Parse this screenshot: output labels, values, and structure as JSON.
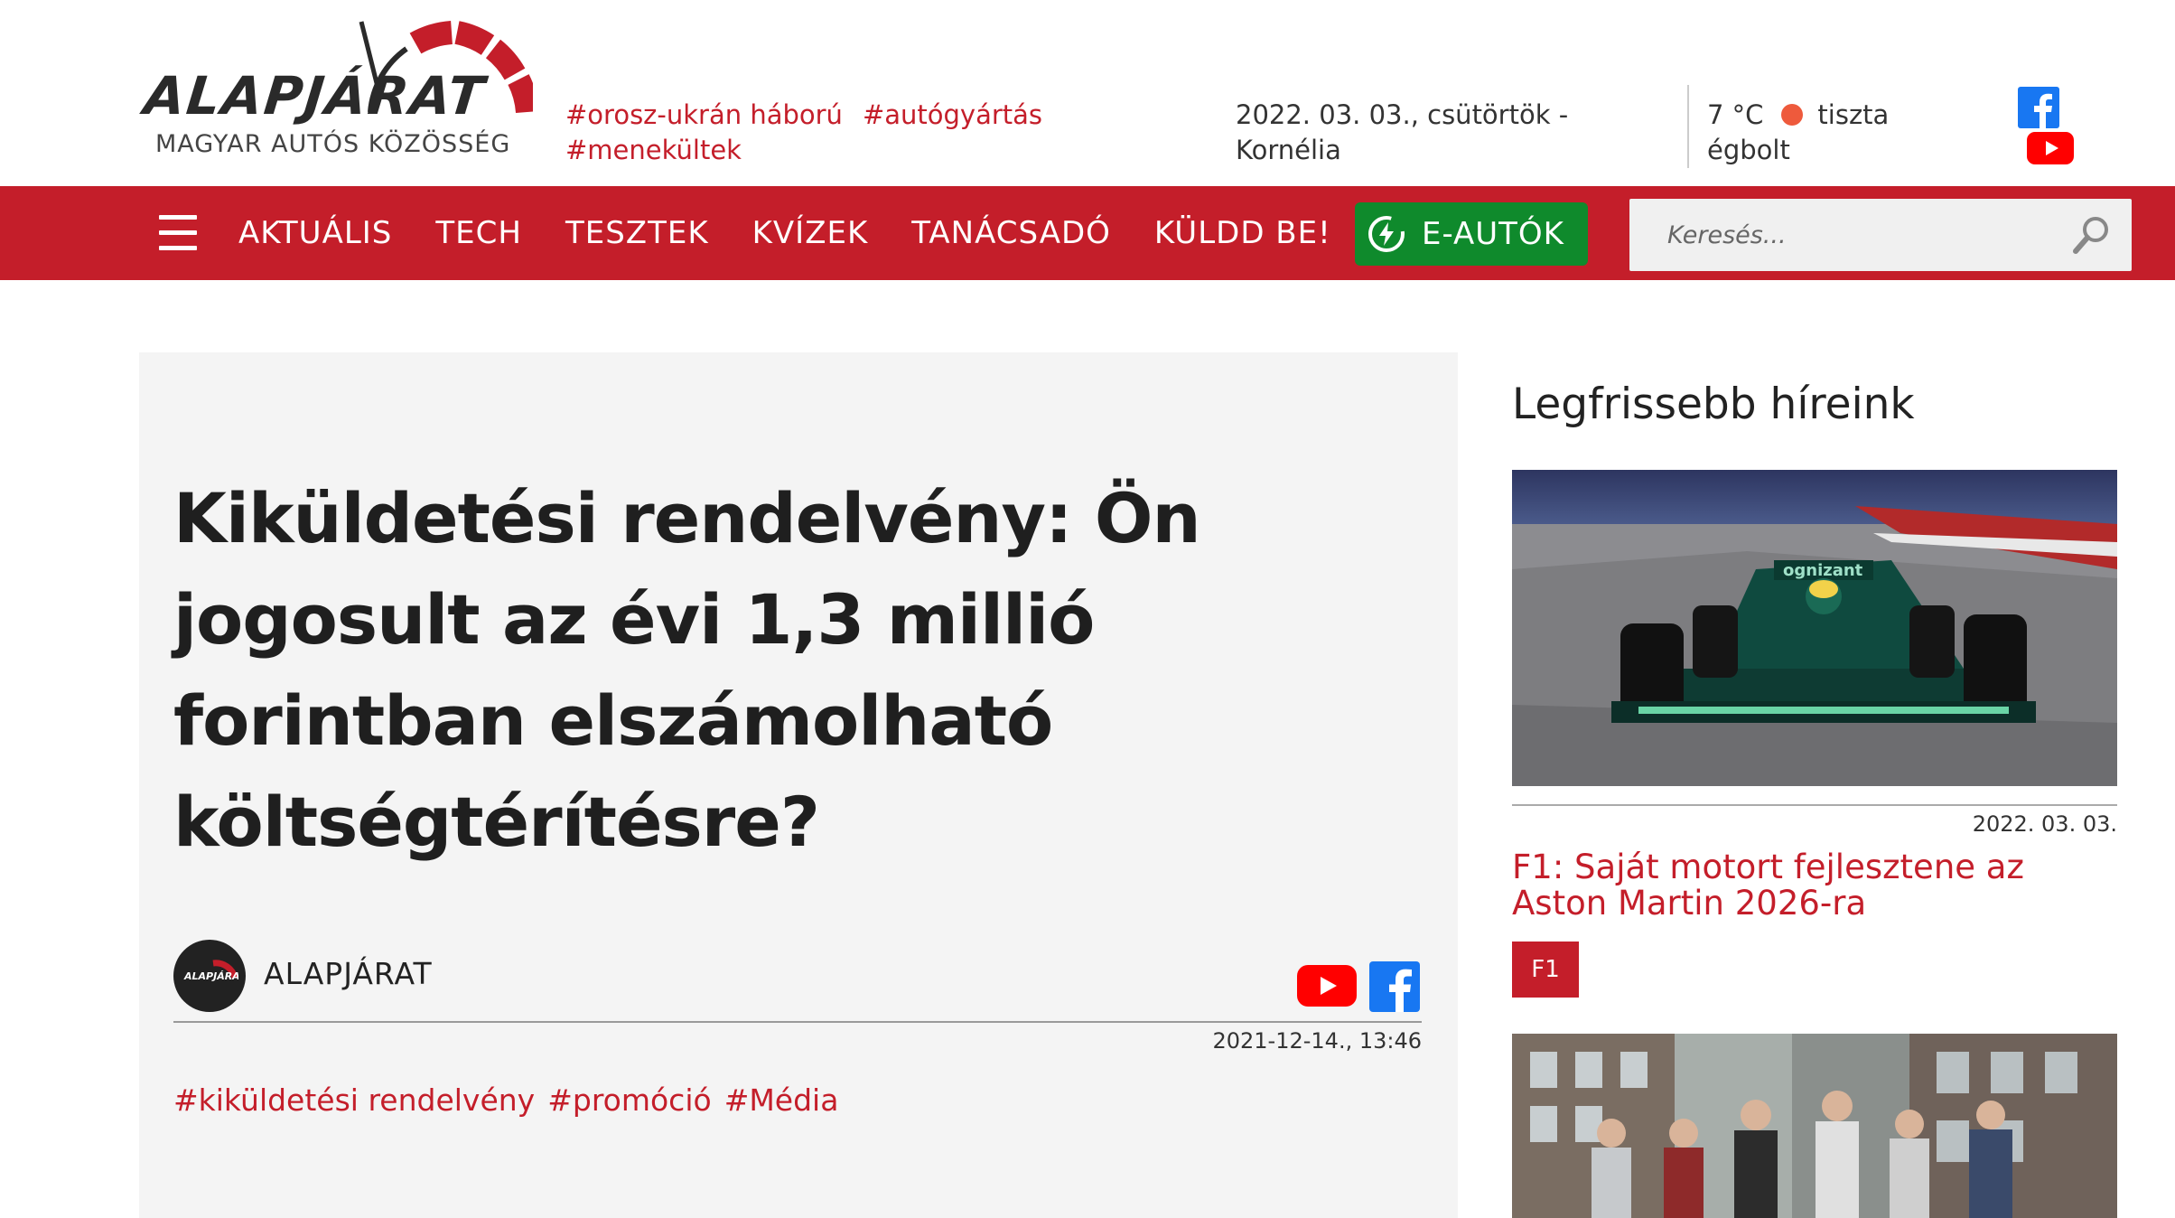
{
  "header": {
    "logo_text": "ALAPJÁRAT",
    "logo_subtitle": "MAGYAR AUTÓS KÖZÖSSÉG",
    "hashtags": [
      "#orosz-ukrán háború",
      "#autógyártás",
      "#menekültek"
    ],
    "date_line1": "2022. 03. 03., csütörtök -",
    "date_line2": "Kornélia",
    "weather_temp": "7 °C",
    "weather_desc1": "tiszta",
    "weather_desc2": "égbolt",
    "social_icons": [
      "facebook-icon",
      "youtube-icon"
    ]
  },
  "nav": {
    "items": [
      "AKTUÁLIS",
      "TECH",
      "TESZTEK",
      "KVÍZEK",
      "TANÁCSADÓ",
      "KÜLDD BE!"
    ],
    "eautok_label": "E-AUTÓK",
    "search_placeholder": "Keresés..."
  },
  "article": {
    "title": "Kiküldetési rendelvény: Ön jogosult az évi 1,3 millió forintban elszámolható költségtérítésre?",
    "author": "ALAPJÁRAT",
    "author_avatar_text": "ALAPJÁRAT",
    "date": "2021-12-14., 13:46",
    "tags": [
      "#kiküldetési rendelvény",
      "#promóció",
      "#Média"
    ]
  },
  "sidebar": {
    "title": "Legfrissebb híreink",
    "news": [
      {
        "date": "2022. 03. 03.",
        "title": "F1: Saját motort fejlesztene az Aston Martin 2026-ra",
        "badge": "F1",
        "image_caption": "ognizant"
      }
    ]
  },
  "colors": {
    "brand_red": "#c41e2a",
    "eautok_green": "#0f8a2c",
    "article_bg": "#f4f4f4"
  }
}
